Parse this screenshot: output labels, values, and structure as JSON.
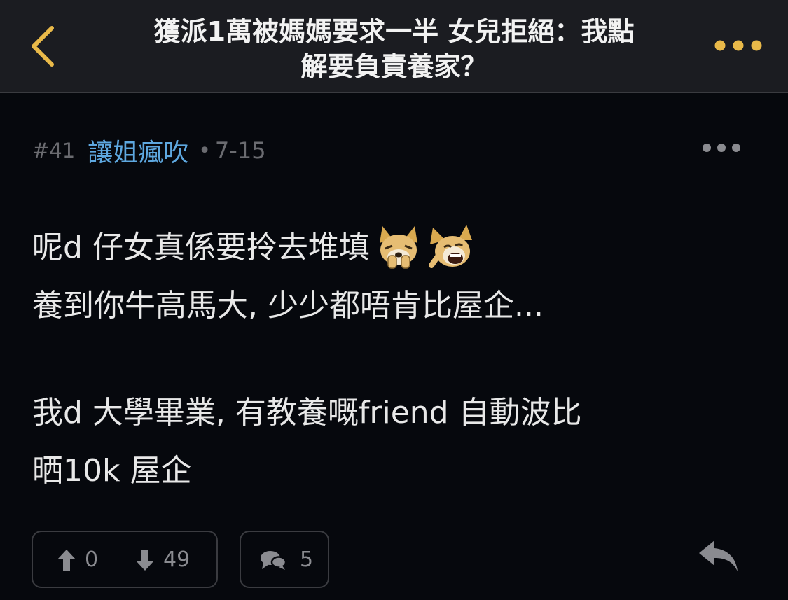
{
  "header": {
    "title_line1": "獲派1萬被媽媽要求一半 女兒拒絕：我點",
    "title_line2": "解要負責養家？",
    "back_icon": "chevron-left-icon",
    "more_icon": "more-horizontal-icon",
    "accent_color": "#e9b949"
  },
  "post": {
    "floor": "#41",
    "author": "讓姐瘋吹",
    "separator": "•",
    "date": "7-15",
    "author_color": "#5ea8e0",
    "content": {
      "line1": "呢d 仔女真係要拎去堆填",
      "line2": "養到你牛高馬大, 少少都唔肯比屋企...",
      "line3": "我d 大學畢業, 有教養嘅friend 自動波比",
      "line4": "晒10k 屋企"
    },
    "emojis": [
      "dog-facepalm-emoji",
      "dog-laughing-emoji"
    ],
    "actions": {
      "upvotes": "0",
      "downvotes": "49",
      "replies": "5",
      "upvote_icon": "arrow-up-icon",
      "downvote_icon": "arrow-down-icon",
      "comment_icon": "comment-bubbles-icon",
      "reply_icon": "reply-arrow-icon"
    }
  }
}
